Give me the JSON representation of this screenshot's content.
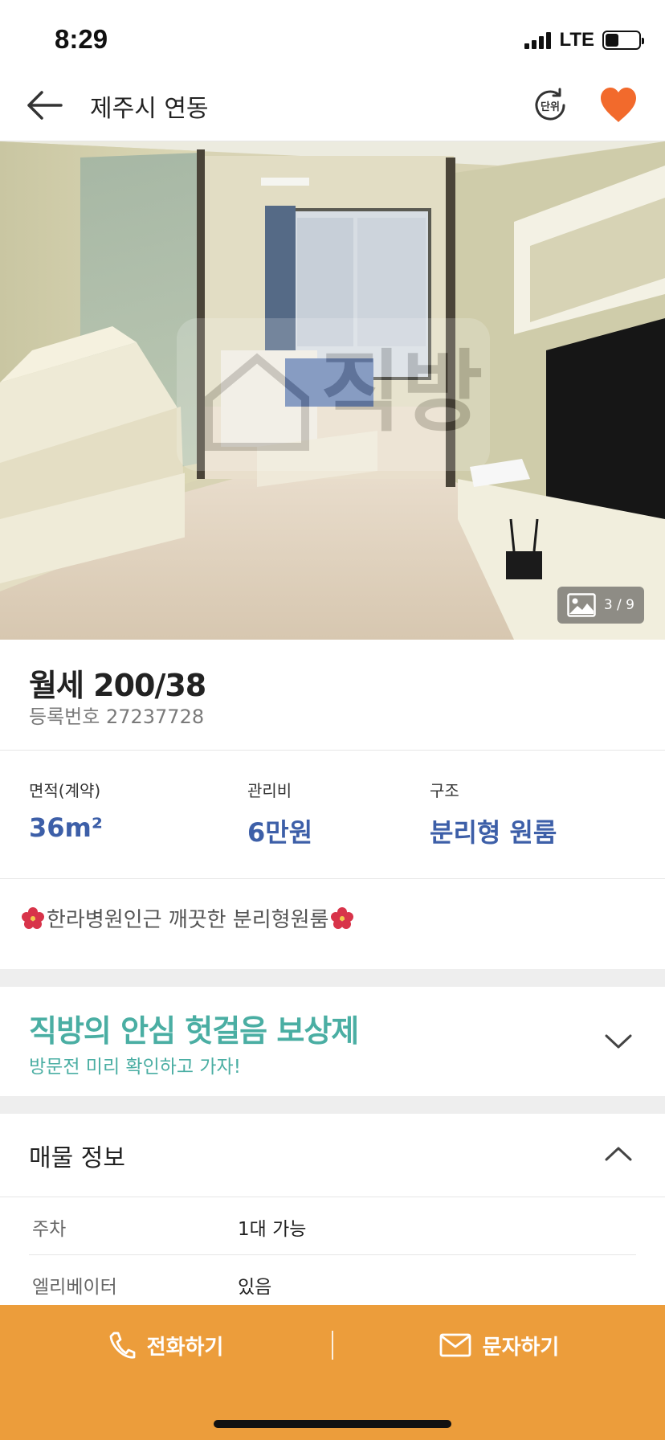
{
  "status_bar": {
    "time": "8:29",
    "network": "LTE",
    "battery_level": 0.4,
    "signal_bars": 4
  },
  "nav": {
    "title": "제주시 연동",
    "unit_button_label": "단위",
    "favorite_active": true,
    "favorite_color": "#f26a2c"
  },
  "photo": {
    "counter": "3 / 9",
    "watermark": "직방"
  },
  "listing": {
    "price": "월세 200/38",
    "registration": "등록번호 27237728"
  },
  "specs": [
    {
      "label": "면적(계약)",
      "value": "36m²"
    },
    {
      "label": "관리비",
      "value": "6만원"
    },
    {
      "label": "구조",
      "value": "분리형 원룸"
    }
  ],
  "description": "한라병원인근 깨끗한 분리형원룸",
  "promo": {
    "title": "직방의 안심 헛걸음 보상제",
    "subtitle": "방문전 미리 확인하고 가자!",
    "accent_color": "#4aaea3"
  },
  "info_section": {
    "title": "매물 정보",
    "rows": [
      {
        "label": "주차",
        "value": "1대 가능"
      },
      {
        "label": "엘리베이터",
        "value": "있음"
      }
    ]
  },
  "actions": {
    "call_label": "전화하기",
    "message_label": "문자하기",
    "bar_color": "#ec9d3b"
  },
  "colors": {
    "value_blue": "#3d5fa8"
  }
}
